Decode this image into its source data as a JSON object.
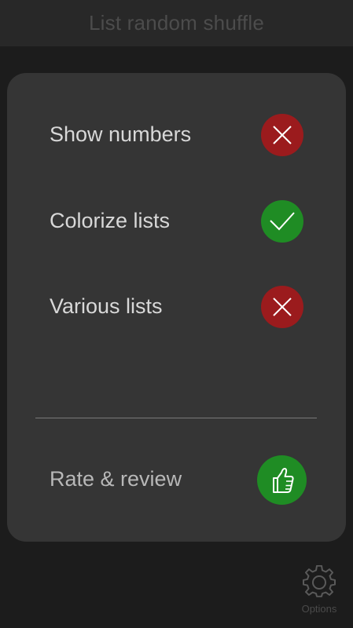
{
  "header": {
    "title": "List random shuffle"
  },
  "settings": {
    "items": [
      {
        "label": "Show numbers",
        "state": "off",
        "icon": "close-icon"
      },
      {
        "label": "Colorize lists",
        "state": "on",
        "icon": "check-icon"
      },
      {
        "label": "Various lists",
        "state": "off",
        "icon": "close-icon"
      }
    ],
    "rate": {
      "label": "Rate & review",
      "icon": "thumbs-up-icon"
    }
  },
  "footer": {
    "options_label": "Options",
    "options_icon": "gear-icon"
  },
  "colors": {
    "background": "#1c1c1c",
    "header": "#282828",
    "panel": "#353535",
    "toggle_off": "#9b1b1d",
    "toggle_on": "#1f8c24"
  }
}
